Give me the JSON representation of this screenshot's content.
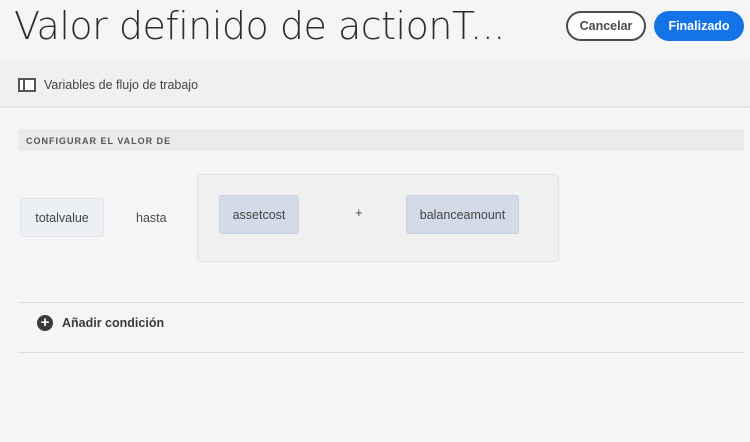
{
  "header": {
    "title": "Valor definido de actionT...",
    "cancel_label": "Cancelar",
    "done_label": "Finalizado"
  },
  "toolbar": {
    "variables_label": "Variables de flujo de trabajo"
  },
  "section": {
    "title": "CONFIGURAR EL VALOR DE"
  },
  "rule": {
    "target": "totalvalue",
    "operator": "hasta",
    "operand1": "assetcost",
    "math_operator": "+",
    "operand2": "balanceamount"
  },
  "actions": {
    "add_condition_label": "Añadir condición"
  },
  "colors": {
    "accent": "#1473e6"
  }
}
